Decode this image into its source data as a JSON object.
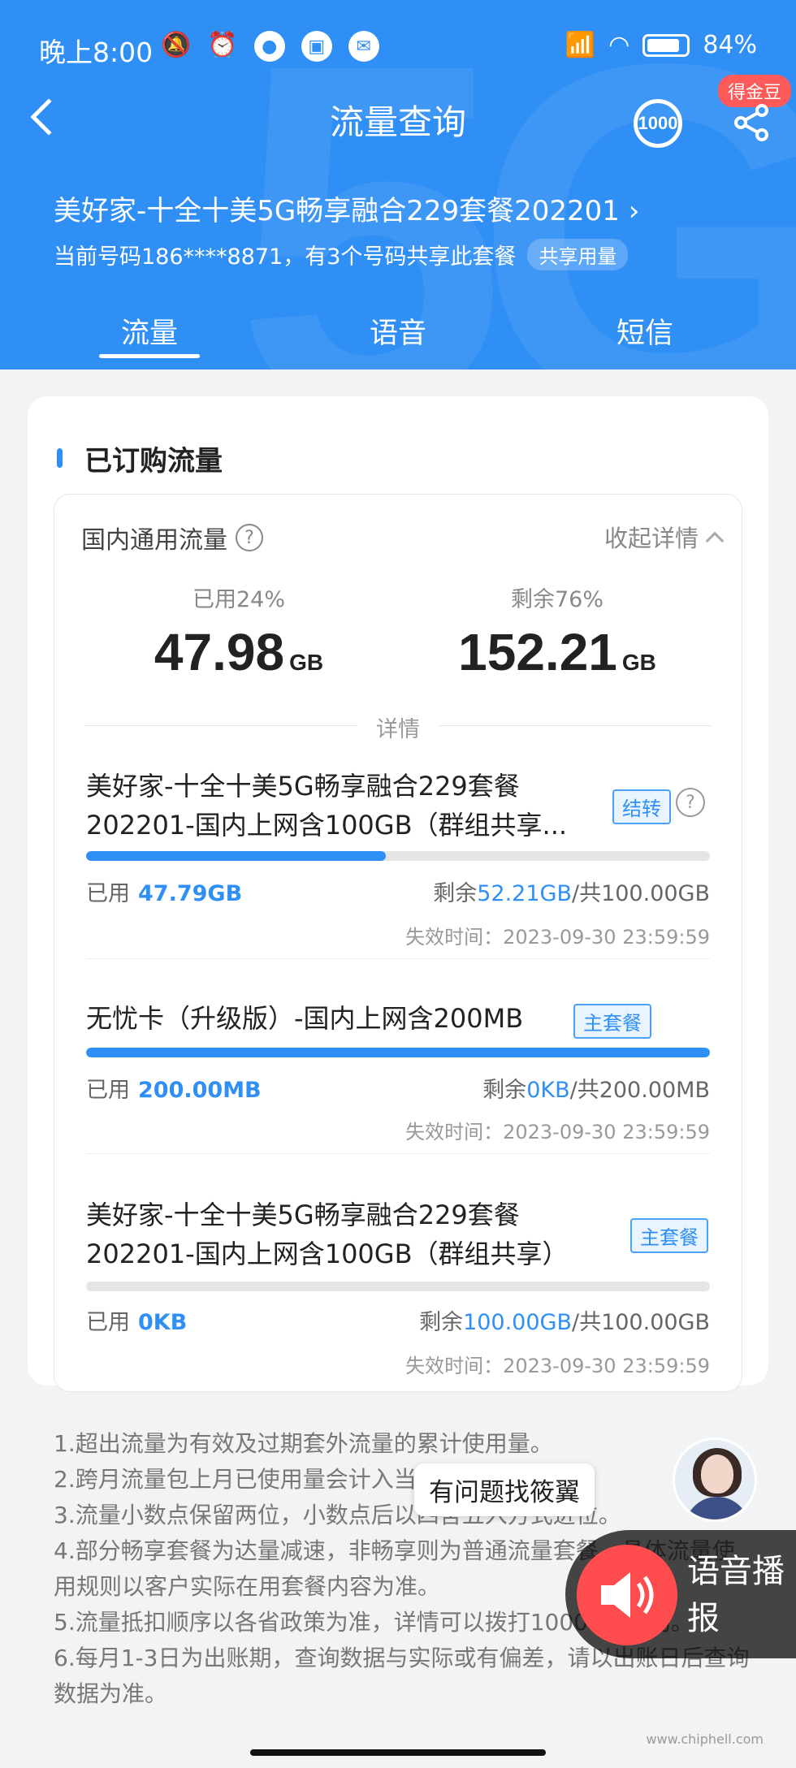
{
  "status_bar": {
    "time": "晚上8:00",
    "battery": "84%"
  },
  "header": {
    "title": "流量查询",
    "service_number": "1000",
    "coin_badge": "得金豆",
    "package_name": "美好家-十全十美5G畅享融合229套餐202201 ›",
    "current_number_text": "当前号码186****8871，有3个号码共享此套餐",
    "shared_tag": "共享用量"
  },
  "tabs": [
    {
      "label": "流量",
      "active": true
    },
    {
      "label": "语音",
      "active": false
    },
    {
      "label": "短信",
      "active": false
    }
  ],
  "section": {
    "title": "已订购流量",
    "domestic_label": "国内通用流量",
    "help": "?",
    "collapse": "收起详情",
    "used_label": "已用24%",
    "used_value": "47.98",
    "used_unit": "GB",
    "remain_label": "剩余76%",
    "remain_value": "152.21",
    "remain_unit": "GB",
    "details_label": "详情"
  },
  "items": [
    {
      "name": "美好家-十全十美5G畅享融合229套餐202201-国内上网含100GB（群组共享...",
      "tag": "结转",
      "used_label": "已用",
      "used": "47.79GB",
      "remain_label": "剩余",
      "remain": "52.21GB",
      "total": "/共100.00GB",
      "expire": "失效时间：2023-09-30 23:59:59",
      "progress": 0.48
    },
    {
      "name": "无忧卡（升级版）-国内上网含200MB",
      "tag": "主套餐",
      "used_label": "已用",
      "used": "200.00MB",
      "remain_label": "剩余",
      "remain": "0KB",
      "total": "/共200.00MB",
      "expire": "失效时间：2023-09-30 23:59:59",
      "progress": 1.0
    },
    {
      "name": "美好家-十全十美5G畅享融合229套餐202201-国内上网含100GB（群组共享）",
      "tag": "主套餐",
      "used_label": "已用",
      "used": "0KB",
      "remain_label": "剩余",
      "remain": "100.00GB",
      "total": "/共100.00GB",
      "expire": "失效时间：2023-09-30 23:59:59",
      "progress": 0.0
    }
  ],
  "notes": [
    "1.超出流量为有效及过期套外流量的累计使用量。",
    "2.跨月流量包上月已使用量会计入当月已使用量中。",
    "3.流量小数点保留两位，小数点后以四舍五入方式进位。",
    "4.部分畅享套餐为达量减速，非畅享则为普通流量套餐，具体流量使用规则以客户实际在用套餐内容为准。",
    "5.流量抵扣顺序以各省政策为准，详情可以拨打10000号咨询。",
    "6.每月1-3日为出账期，查询数据与实际或有偏差，请以出账日后查询数据为准。"
  ],
  "assistant": {
    "bubble": "有问题找筱翼",
    "voice_label": "语音播报"
  },
  "watermark": "www.chiphell.com"
}
